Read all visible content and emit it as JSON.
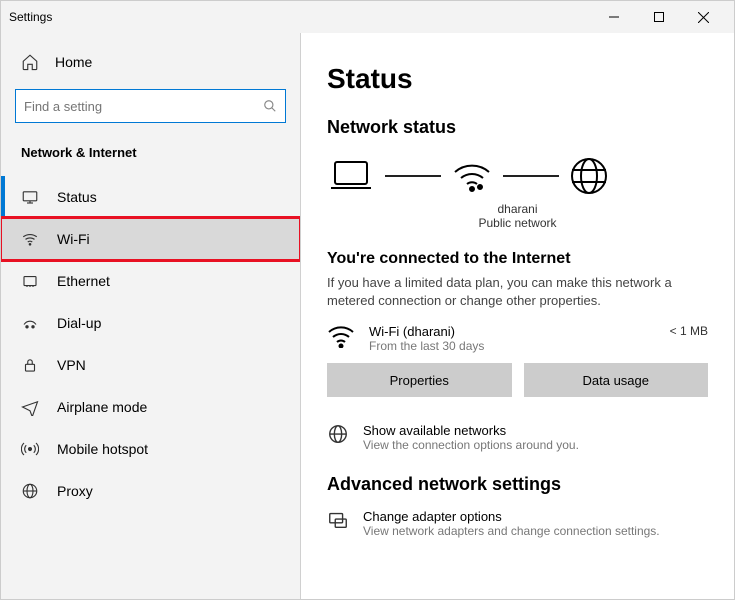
{
  "window": {
    "title": "Settings"
  },
  "sidebar": {
    "home": "Home",
    "search_placeholder": "Find a setting",
    "section": "Network & Internet",
    "items": [
      {
        "label": "Status"
      },
      {
        "label": "Wi-Fi"
      },
      {
        "label": "Ethernet"
      },
      {
        "label": "Dial-up"
      },
      {
        "label": "VPN"
      },
      {
        "label": "Airplane mode"
      },
      {
        "label": "Mobile hotspot"
      },
      {
        "label": "Proxy"
      }
    ]
  },
  "content": {
    "heading": "Status",
    "subheading": "Network status",
    "diagram": {
      "ssid": "dharani",
      "type": "Public network"
    },
    "connected_title": "You're connected to the Internet",
    "connected_desc": "If you have a limited data plan, you can make this network a metered connection or change other properties.",
    "connection": {
      "name": "Wi-Fi (dharani)",
      "sub": "From the last 30 days",
      "usage": "< 1 MB"
    },
    "properties_btn": "Properties",
    "data_usage_btn": "Data usage",
    "show_networks": {
      "title": "Show available networks",
      "sub": "View the connection options around you."
    },
    "advanced_heading": "Advanced network settings",
    "adapter": {
      "title": "Change adapter options",
      "sub": "View network adapters and change connection settings."
    }
  }
}
